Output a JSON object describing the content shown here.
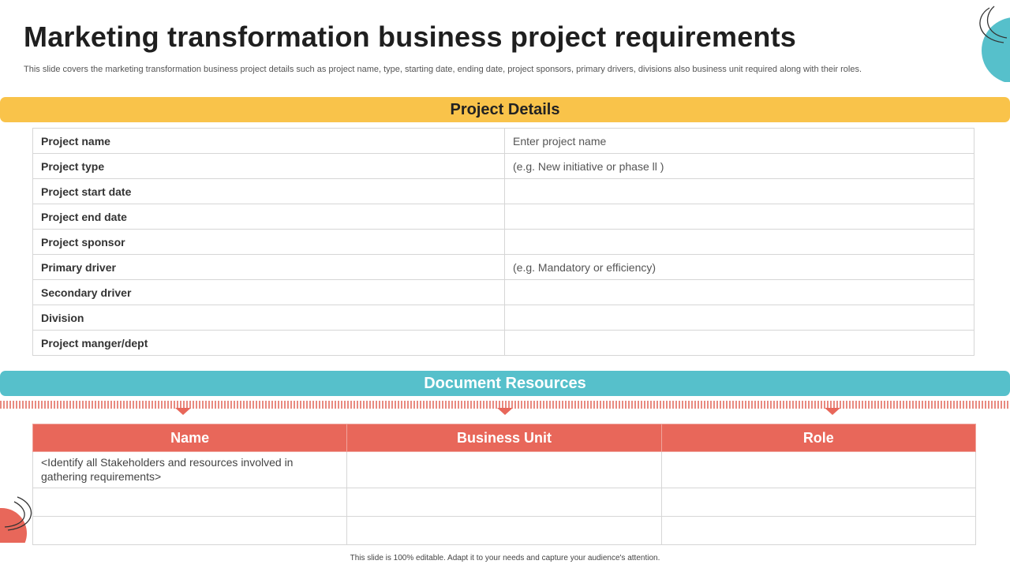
{
  "header": {
    "title": "Marketing transformation business project requirements",
    "subtitle": "This slide covers the marketing transformation business project details such as project name, type, starting date, ending date, project sponsors, primary drivers, divisions also business unit required along with their roles."
  },
  "project_details": {
    "heading": "Project Details",
    "rows": [
      {
        "label": "Project name",
        "value": "Enter project name"
      },
      {
        "label": "Project type",
        "value": "(e.g. New initiative or phase ll )"
      },
      {
        "label": "Project start date",
        "value": ""
      },
      {
        "label": "Project end date",
        "value": ""
      },
      {
        "label": "Project sponsor",
        "value": ""
      },
      {
        "label": "Primary driver",
        "value": "(e.g. Mandatory or efficiency)"
      },
      {
        "label": "Secondary driver",
        "value": ""
      },
      {
        "label": "Division",
        "value": ""
      },
      {
        "label": "Project manger/dept",
        "value": ""
      }
    ]
  },
  "document_resources": {
    "heading": "Document Resources",
    "columns": [
      "Name",
      "Business Unit",
      "Role"
    ],
    "rows": [
      [
        "<Identify all Stakeholders and resources involved in gathering requirements>",
        "",
        ""
      ],
      [
        "",
        "",
        ""
      ],
      [
        "",
        "",
        ""
      ]
    ]
  },
  "footer": {
    "note": "This slide is 100% editable. Adapt it to your needs and capture your audience's attention."
  },
  "colors": {
    "yellow_band": "#f9c34a",
    "teal_band": "#56c0cb",
    "coral": "#e8675a"
  },
  "icons": [
    "corner-circle-decoration-icon",
    "arc-outline-decoration-icon"
  ]
}
